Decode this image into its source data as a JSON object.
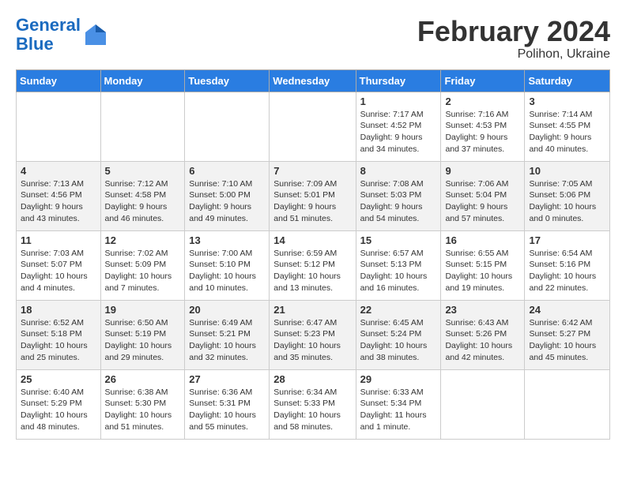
{
  "header": {
    "logo_line1": "General",
    "logo_line2": "Blue",
    "title": "February 2024",
    "subtitle": "Polihon, Ukraine"
  },
  "days_of_week": [
    "Sunday",
    "Monday",
    "Tuesday",
    "Wednesday",
    "Thursday",
    "Friday",
    "Saturday"
  ],
  "weeks": [
    [
      {
        "day": "",
        "info": ""
      },
      {
        "day": "",
        "info": ""
      },
      {
        "day": "",
        "info": ""
      },
      {
        "day": "",
        "info": ""
      },
      {
        "day": "1",
        "info": "Sunrise: 7:17 AM\nSunset: 4:52 PM\nDaylight: 9 hours\nand 34 minutes."
      },
      {
        "day": "2",
        "info": "Sunrise: 7:16 AM\nSunset: 4:53 PM\nDaylight: 9 hours\nand 37 minutes."
      },
      {
        "day": "3",
        "info": "Sunrise: 7:14 AM\nSunset: 4:55 PM\nDaylight: 9 hours\nand 40 minutes."
      }
    ],
    [
      {
        "day": "4",
        "info": "Sunrise: 7:13 AM\nSunset: 4:56 PM\nDaylight: 9 hours\nand 43 minutes."
      },
      {
        "day": "5",
        "info": "Sunrise: 7:12 AM\nSunset: 4:58 PM\nDaylight: 9 hours\nand 46 minutes."
      },
      {
        "day": "6",
        "info": "Sunrise: 7:10 AM\nSunset: 5:00 PM\nDaylight: 9 hours\nand 49 minutes."
      },
      {
        "day": "7",
        "info": "Sunrise: 7:09 AM\nSunset: 5:01 PM\nDaylight: 9 hours\nand 51 minutes."
      },
      {
        "day": "8",
        "info": "Sunrise: 7:08 AM\nSunset: 5:03 PM\nDaylight: 9 hours\nand 54 minutes."
      },
      {
        "day": "9",
        "info": "Sunrise: 7:06 AM\nSunset: 5:04 PM\nDaylight: 9 hours\nand 57 minutes."
      },
      {
        "day": "10",
        "info": "Sunrise: 7:05 AM\nSunset: 5:06 PM\nDaylight: 10 hours\nand 0 minutes."
      }
    ],
    [
      {
        "day": "11",
        "info": "Sunrise: 7:03 AM\nSunset: 5:07 PM\nDaylight: 10 hours\nand 4 minutes."
      },
      {
        "day": "12",
        "info": "Sunrise: 7:02 AM\nSunset: 5:09 PM\nDaylight: 10 hours\nand 7 minutes."
      },
      {
        "day": "13",
        "info": "Sunrise: 7:00 AM\nSunset: 5:10 PM\nDaylight: 10 hours\nand 10 minutes."
      },
      {
        "day": "14",
        "info": "Sunrise: 6:59 AM\nSunset: 5:12 PM\nDaylight: 10 hours\nand 13 minutes."
      },
      {
        "day": "15",
        "info": "Sunrise: 6:57 AM\nSunset: 5:13 PM\nDaylight: 10 hours\nand 16 minutes."
      },
      {
        "day": "16",
        "info": "Sunrise: 6:55 AM\nSunset: 5:15 PM\nDaylight: 10 hours\nand 19 minutes."
      },
      {
        "day": "17",
        "info": "Sunrise: 6:54 AM\nSunset: 5:16 PM\nDaylight: 10 hours\nand 22 minutes."
      }
    ],
    [
      {
        "day": "18",
        "info": "Sunrise: 6:52 AM\nSunset: 5:18 PM\nDaylight: 10 hours\nand 25 minutes."
      },
      {
        "day": "19",
        "info": "Sunrise: 6:50 AM\nSunset: 5:19 PM\nDaylight: 10 hours\nand 29 minutes."
      },
      {
        "day": "20",
        "info": "Sunrise: 6:49 AM\nSunset: 5:21 PM\nDaylight: 10 hours\nand 32 minutes."
      },
      {
        "day": "21",
        "info": "Sunrise: 6:47 AM\nSunset: 5:23 PM\nDaylight: 10 hours\nand 35 minutes."
      },
      {
        "day": "22",
        "info": "Sunrise: 6:45 AM\nSunset: 5:24 PM\nDaylight: 10 hours\nand 38 minutes."
      },
      {
        "day": "23",
        "info": "Sunrise: 6:43 AM\nSunset: 5:26 PM\nDaylight: 10 hours\nand 42 minutes."
      },
      {
        "day": "24",
        "info": "Sunrise: 6:42 AM\nSunset: 5:27 PM\nDaylight: 10 hours\nand 45 minutes."
      }
    ],
    [
      {
        "day": "25",
        "info": "Sunrise: 6:40 AM\nSunset: 5:29 PM\nDaylight: 10 hours\nand 48 minutes."
      },
      {
        "day": "26",
        "info": "Sunrise: 6:38 AM\nSunset: 5:30 PM\nDaylight: 10 hours\nand 51 minutes."
      },
      {
        "day": "27",
        "info": "Sunrise: 6:36 AM\nSunset: 5:31 PM\nDaylight: 10 hours\nand 55 minutes."
      },
      {
        "day": "28",
        "info": "Sunrise: 6:34 AM\nSunset: 5:33 PM\nDaylight: 10 hours\nand 58 minutes."
      },
      {
        "day": "29",
        "info": "Sunrise: 6:33 AM\nSunset: 5:34 PM\nDaylight: 11 hours\nand 1 minute."
      },
      {
        "day": "",
        "info": ""
      },
      {
        "day": "",
        "info": ""
      }
    ]
  ]
}
